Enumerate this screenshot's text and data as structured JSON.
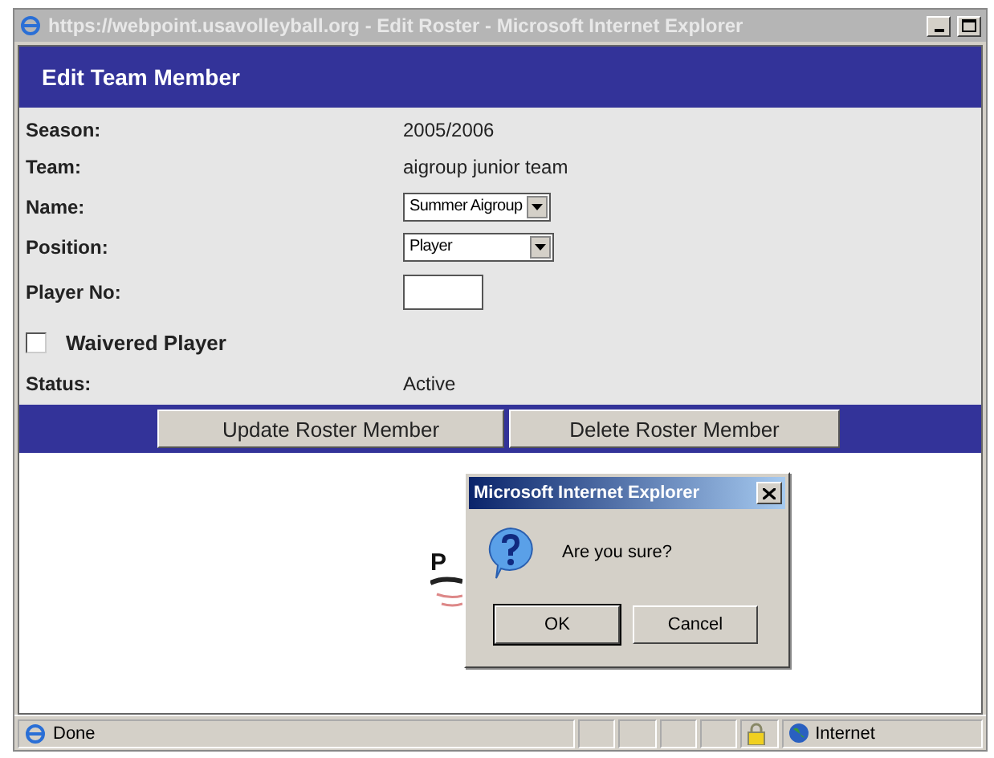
{
  "window": {
    "title": "https://webpoint.usavolleyball.org - Edit Roster - Microsoft Internet Explorer"
  },
  "header": {
    "title": "Edit Team Member"
  },
  "fields": [
    {
      "kind": "text",
      "label": "Season:",
      "value": "2005/2006"
    },
    {
      "kind": "text",
      "label": "Team:",
      "value": "aigroup junior team"
    },
    {
      "kind": "select",
      "label": "Name:",
      "value": "Summer Aigroup"
    },
    {
      "kind": "select",
      "label": "Position:",
      "value": "Player"
    },
    {
      "kind": "input",
      "label": "Player No:"
    },
    {
      "kind": "checkbox",
      "label": "Waivered Player",
      "checked": false
    },
    {
      "kind": "text",
      "label": "Status:",
      "value": "Active"
    }
  ],
  "buttons": [
    "Update Roster Member",
    "Delete Roster Member"
  ],
  "logo_text": "P",
  "dialog": {
    "title": "Microsoft Internet Explorer",
    "message": "Are you sure?",
    "buttons": [
      "OK",
      "Cancel"
    ]
  },
  "status_bar": {
    "text": "Done",
    "zone": "Internet"
  }
}
